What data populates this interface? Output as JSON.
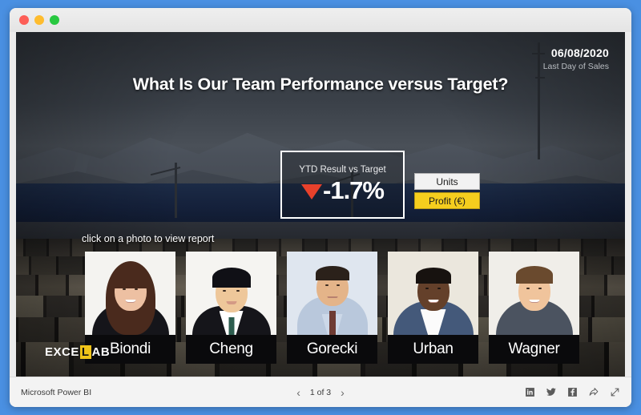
{
  "window": {
    "controls": [
      "close",
      "minimize",
      "maximize"
    ]
  },
  "report": {
    "date": {
      "value": "06/08/2020",
      "caption": "Last Day of Sales"
    },
    "headline": "What Is Our Team Performance versus Target?",
    "kpi": {
      "label": "YTD Result vs Target",
      "value": "-1.7%",
      "trend": "down",
      "trend_color": "#e8412b"
    },
    "measure_toggle": {
      "options": [
        {
          "label": "Units",
          "selected": false
        },
        {
          "label": "Profit (€)",
          "selected": true
        }
      ],
      "selected_color": "#f5ce1e",
      "unselected_color": "#f2f2f2"
    },
    "hint": "click on a photo to view report",
    "people": [
      {
        "name": "Biondi"
      },
      {
        "name": "Cheng"
      },
      {
        "name": "Gorecki"
      },
      {
        "name": "Urban"
      },
      {
        "name": "Wagner"
      }
    ],
    "logo": {
      "part1": "EXCE",
      "highlight": "L",
      "part2": "AB",
      "highlight_color": "#f0c419"
    }
  },
  "footer": {
    "brand": "Microsoft Power BI",
    "pager": {
      "prev": "‹",
      "label": "1 of 3",
      "next": "›"
    },
    "social": [
      {
        "name": "linkedin-icon"
      },
      {
        "name": "twitter-icon"
      },
      {
        "name": "facebook-icon"
      },
      {
        "name": "share-icon"
      },
      {
        "name": "fullscreen-icon"
      }
    ]
  }
}
